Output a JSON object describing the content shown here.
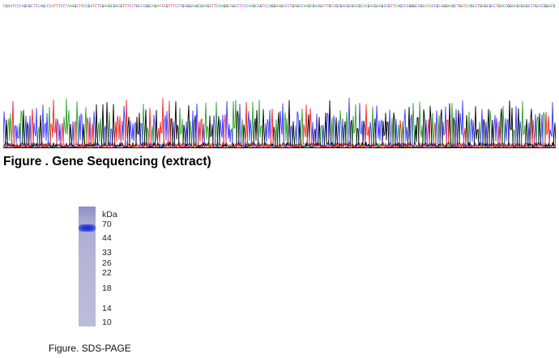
{
  "sequence": {
    "text": "CGAATCCCAGCGCTCCAGCCCATTTCCTAAAGCTACCGATCTCGAAGCGACGTTTCCTGCCCGGCAGATACGTTTCCTGCGGAAGCGACGCTTCAAGGCAGCCTCCCAAGCAGTCCAGGAAGCCCTGAGCCAAGCGACGATTGTCGCGACGCGACGCACGACGAAGCCGTTCAGCCCGGGCAGCATACCGCAGGAAGCTGATCAGCCTGAGCGCCTGACCGGACGCGAGCCTGACCGGACGCAAGCGTCAGCATTCCG",
    "trace_colors": {
      "A": "#2ca02c",
      "C": "#3a3aff",
      "G": "#000000",
      "T": "#ff2020"
    }
  },
  "figure1": {
    "caption": "Figure . Gene Sequencing (extract)"
  },
  "gel": {
    "unit": "kDa",
    "markers": [
      {
        "label": "70",
        "kda": 70
      },
      {
        "label": "44",
        "kda": 44
      },
      {
        "label": "33",
        "kda": 33
      },
      {
        "label": "26",
        "kda": 26
      },
      {
        "label": "22",
        "kda": 22
      },
      {
        "label": "18",
        "kda": 18
      },
      {
        "label": "14",
        "kda": 14
      },
      {
        "label": "10",
        "kda": 10
      }
    ],
    "band_color": "#1f2fd8",
    "lane_color": "#b0b0d6"
  },
  "figure2": {
    "caption": "Figure. SDS-PAGE"
  }
}
